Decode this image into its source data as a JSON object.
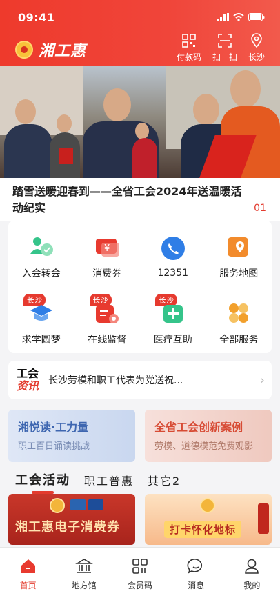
{
  "status": {
    "time": "09:41"
  },
  "header": {
    "brand": "湘工惠",
    "actions": [
      {
        "label": "付款码",
        "icon": "qrcode-icon"
      },
      {
        "label": "扫一扫",
        "icon": "scan-icon"
      },
      {
        "label": "长沙",
        "icon": "location-icon"
      }
    ]
  },
  "banner": {
    "title": "踏雪送暖迎春到——全省工会2024年送温暖活动纪实",
    "page": "01"
  },
  "services": [
    {
      "label": "入会转会",
      "icon": "join-union-icon",
      "color": "#35c48a"
    },
    {
      "label": "消费券",
      "icon": "coupon-icon",
      "color": "#e83a2f"
    },
    {
      "label": "12351",
      "icon": "phone-icon",
      "color": "#2f7ee6"
    },
    {
      "label": "服务地图",
      "icon": "map-icon",
      "color": "#f28b2c"
    },
    {
      "label": "求学圆梦",
      "icon": "graduation-cap-icon",
      "color": "#2f7ee6",
      "tag": "长沙"
    },
    {
      "label": "在线监督",
      "icon": "supervision-icon",
      "color": "#e83a2f",
      "tag": "长沙"
    },
    {
      "label": "医疗互助",
      "icon": "medical-icon",
      "color": "#35c48a",
      "tag": "长沙"
    },
    {
      "label": "全部服务",
      "icon": "all-services-icon",
      "color": "#f2a02c"
    }
  ],
  "news": {
    "logo_line1": "工会",
    "logo_line2": "资讯",
    "text": "长沙劳模和职工代表为党送祝..."
  },
  "promos": [
    {
      "title": "湘悦读·工力量",
      "subtitle": "职工百日诵读挑战"
    },
    {
      "title": "全省工会创新案例",
      "subtitle": "劳模、道德模范免费观影"
    }
  ],
  "tabs": [
    "工会活动",
    "职工普惠",
    "其它2"
  ],
  "activities": [
    {
      "title": "湘工惠电子消费券"
    },
    {
      "title": "打卡怀化地标"
    }
  ],
  "tabbar": [
    {
      "label": "首页",
      "icon": "home-icon",
      "active": true
    },
    {
      "label": "地方馆",
      "icon": "hall-icon"
    },
    {
      "label": "会员码",
      "icon": "member-code-icon"
    },
    {
      "label": "消息",
      "icon": "message-icon"
    },
    {
      "label": "我的",
      "icon": "profile-icon"
    }
  ]
}
